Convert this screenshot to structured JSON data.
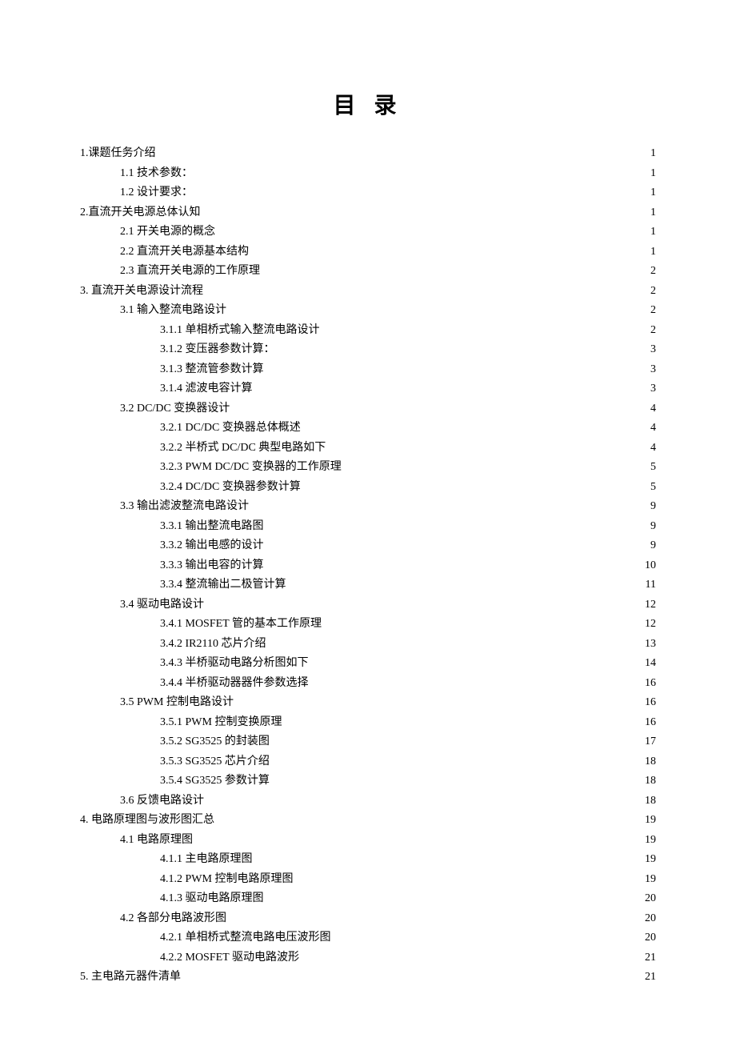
{
  "title": "目 录",
  "toc": [
    {
      "level": 1,
      "text": "1.课题任务介绍",
      "page": "1",
      "prefixSans": "1."
    },
    {
      "level": 2,
      "text": "1.1 技术参数：",
      "page": "1"
    },
    {
      "level": 2,
      "text": "1.2 设计要求：",
      "page": "1"
    },
    {
      "level": 1,
      "text": "2.直流开关电源总体认知",
      "page": "1"
    },
    {
      "level": 2,
      "text": "2.1 开关电源的概念",
      "page": "1"
    },
    {
      "level": 2,
      "text": "2.2 直流开关电源基本结构",
      "page": "1"
    },
    {
      "level": 2,
      "text": "2.3 直流开关电源的工作原理",
      "page": "2"
    },
    {
      "level": 1,
      "text": "3. 直流开关电源设计流程",
      "page": "2"
    },
    {
      "level": 2,
      "text": "3.1 输入整流电路设计",
      "page": "2"
    },
    {
      "level": 3,
      "text": "3.1.1 单相桥式输入整流电路设计",
      "page": "2"
    },
    {
      "level": 3,
      "text": "3.1.2 变压器参数计算：",
      "page": "3"
    },
    {
      "level": 3,
      "text": "3.1.3 整流管参数计算",
      "page": "3"
    },
    {
      "level": 3,
      "text": "3.1.4 滤波电容计算",
      "page": "3"
    },
    {
      "level": 2,
      "text": "3.2 DC/DC 变换器设计",
      "page": "4"
    },
    {
      "level": 3,
      "text": "3.2.1 DC/DC 变换器总体概述",
      "page": "4"
    },
    {
      "level": 3,
      "text": "3.2.2 半桥式 DC/DC 典型电路如下",
      "page": "4"
    },
    {
      "level": 3,
      "text": "3.2.3 PWM DC/DC 变换器的工作原理",
      "page": "5"
    },
    {
      "level": 3,
      "text": "3.2.4 DC/DC 变换器参数计算",
      "page": "5"
    },
    {
      "level": 2,
      "text": "3.3 输出滤波整流电路设计",
      "page": "9",
      "prefixSans": "3.3"
    },
    {
      "level": 3,
      "text": "3.3.1 输出整流电路图",
      "page": "9",
      "prefixSans": "3.3.1"
    },
    {
      "level": 3,
      "text": "3.3.2 输出电感的设计",
      "page": "9",
      "prefixSans": "3.3.2"
    },
    {
      "level": 3,
      "text": "3.3.3 输出电容的计算",
      "page": "10",
      "prefixSans": "3.3.3"
    },
    {
      "level": 3,
      "text": "3.3.4 整流输出二极管计算",
      "page": "11",
      "prefixSans": "3.3.4"
    },
    {
      "level": 2,
      "text": "3.4 驱动电路设计",
      "page": "12"
    },
    {
      "level": 3,
      "text": "3.4.1 MOSFET 管的基本工作原理",
      "page": "12"
    },
    {
      "level": 3,
      "text": "3.4.2 IR2110 芯片介绍",
      "page": "13"
    },
    {
      "level": 3,
      "text": "3.4.3 半桥驱动电路分析图如下",
      "page": "14"
    },
    {
      "level": 3,
      "text": "3.4.4 半桥驱动器器件参数选择",
      "page": "16"
    },
    {
      "level": 2,
      "text": "3.5 PWM 控制电路设计",
      "page": "16"
    },
    {
      "level": 3,
      "text": "3.5.1 PWM 控制变换原理",
      "page": "16"
    },
    {
      "level": 3,
      "text": "3.5.2 SG3525 的封装图",
      "page": "17"
    },
    {
      "level": 3,
      "text": "3.5.3 SG3525 芯片介绍",
      "page": "18"
    },
    {
      "level": 3,
      "text": "3.5.4 SG3525 参数计算",
      "page": "18"
    },
    {
      "level": 2,
      "text": "3.6 反馈电路设计",
      "page": "18"
    },
    {
      "level": 1,
      "text": "4. 电路原理图与波形图汇总",
      "page": "19"
    },
    {
      "level": 2,
      "text": "4.1 电路原理图",
      "page": "19"
    },
    {
      "level": 3,
      "text": "4.1.1 主电路原理图",
      "page": "19"
    },
    {
      "level": 3,
      "text": "4.1.2 PWM 控制电路原理图",
      "page": "19"
    },
    {
      "level": 3,
      "text": "4.1.3 驱动电路原理图",
      "page": "20"
    },
    {
      "level": 2,
      "text": "4.2 各部分电路波形图",
      "page": "20"
    },
    {
      "level": 3,
      "text": "4.2.1 单相桥式整流电路电压波形图",
      "page": "20"
    },
    {
      "level": 3,
      "text": "4.2.2 MOSFET 驱动电路波形",
      "page": "21"
    },
    {
      "level": 1,
      "text": "5. 主电路元器件清单",
      "page": "21"
    }
  ]
}
